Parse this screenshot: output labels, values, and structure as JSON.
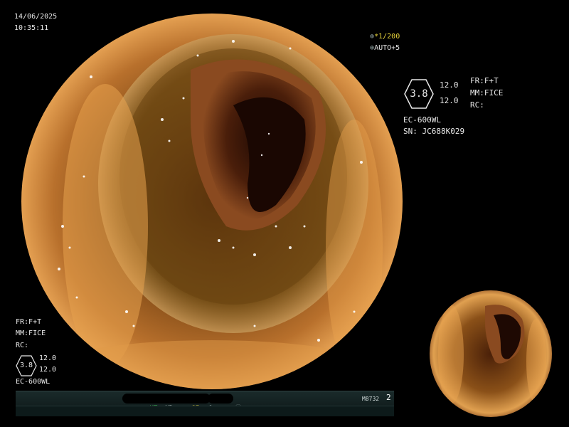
{
  "overlay": {
    "date": "14/06/2025",
    "time": "10:35:11",
    "shutter": "1/200",
    "auto_exposure": "AUTO+5"
  },
  "right_panel": {
    "enhancement_value": "3.8",
    "param_top": "12.0",
    "param_bottom": "12.0",
    "fr": "FR:F+T",
    "mm": "MM:FICE",
    "rc": "RC:",
    "scope_model": "EC-600WL",
    "serial": "SN: JC688K029"
  },
  "left_panel": {
    "fr": "FR:F+T",
    "mm": "MM:FICE",
    "rc": "RC:",
    "enhancement_value": "3.8",
    "param_top": "12.0",
    "param_bottom": "12.0",
    "scope_model": "EC-600WL"
  },
  "statusbar": {
    "ht": "HT",
    "nr": "NR",
    "se": "SE",
    "device_code": "M8732",
    "channel": "2"
  },
  "icons": [
    "shutter-icon",
    "auto-icon",
    "scissors-icon",
    "freeze-icon",
    "record-icon"
  ],
  "colors": {
    "tissue_highlight": "#e89a4a",
    "tissue_mid": "#8a4a1a",
    "lumen_dark": "#2a0e04",
    "status_green": "#3fcf5a",
    "status_yellow": "#e6d23a"
  }
}
